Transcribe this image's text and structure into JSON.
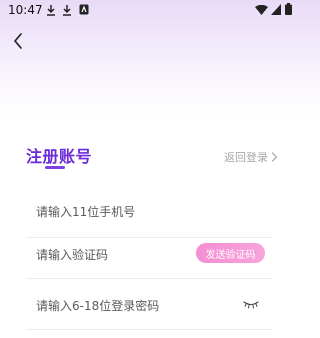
{
  "status_bar": {
    "time": "10:47",
    "left_icons": [
      "download-icon",
      "download-icon",
      "app-notification-icon"
    ],
    "right_icons": [
      "wifi-icon",
      "signal-icon",
      "battery-icon"
    ]
  },
  "header": {
    "back_icon": "chevron-left-icon"
  },
  "page": {
    "title": "注册账号",
    "return_login": "返回登录",
    "return_icon": "chevron-right-icon"
  },
  "form": {
    "phone_placeholder": "请输入11位手机号",
    "code_placeholder": "请输入验证码",
    "send_code_label": "发送验证码",
    "password_placeholder": "请输入6-18位登录密码",
    "password_toggle_icon": "eye-closed-icon"
  },
  "colors": {
    "accent": "#6a2bd8",
    "send_button": "#f58fd3",
    "header_gradient_top": "#e9dbf7"
  }
}
